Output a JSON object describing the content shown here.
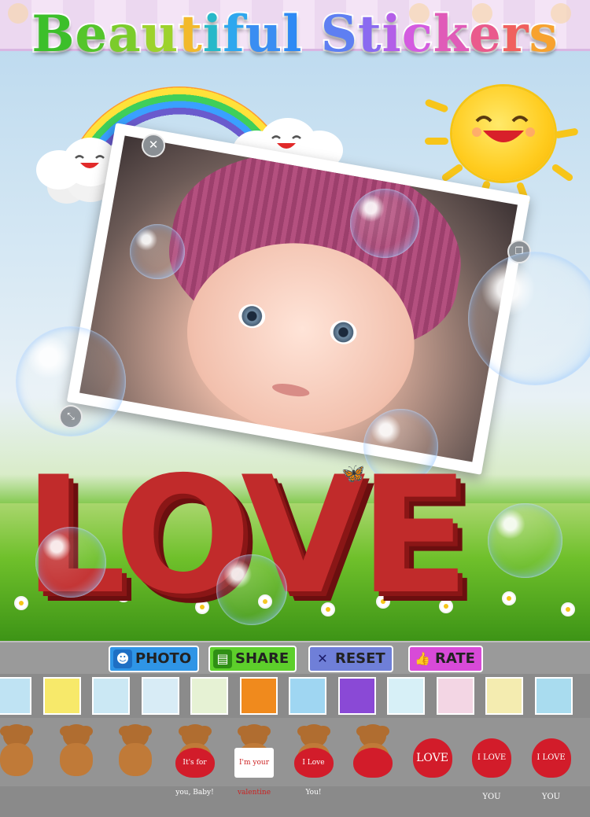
{
  "app": {
    "title_letters": [
      {
        "ch": "B",
        "color": "#3cbf2a"
      },
      {
        "ch": "e",
        "color": "#55c52b"
      },
      {
        "ch": "a",
        "color": "#7bcc2b"
      },
      {
        "ch": "u",
        "color": "#9dd22c"
      },
      {
        "ch": "t",
        "color": "#f2b92b"
      },
      {
        "ch": "i",
        "color": "#27b8c9"
      },
      {
        "ch": "f",
        "color": "#2ea7ee"
      },
      {
        "ch": "u",
        "color": "#3a8ef2"
      },
      {
        "ch": "l",
        "color": "#2e8af4"
      },
      {
        "ch": " ",
        "color": "#000000"
      },
      {
        "ch": "S",
        "color": "#5e7ff2"
      },
      {
        "ch": "t",
        "color": "#8a6af0"
      },
      {
        "ch": "i",
        "color": "#b35ee8"
      },
      {
        "ch": "c",
        "color": "#d45be0"
      },
      {
        "ch": "k",
        "color": "#e05bb8"
      },
      {
        "ch": "e",
        "color": "#ea5a8c"
      },
      {
        "ch": "r",
        "color": "#f0605e"
      },
      {
        "ch": "s",
        "color": "#f7a22f"
      }
    ]
  },
  "canvas": {
    "love_text": "LOVE"
  },
  "toolbar": {
    "buttons": [
      {
        "name": "photo-button",
        "label": "PHOTO",
        "icon": "person-icon",
        "color": "#2f95e6"
      },
      {
        "name": "share-button",
        "label": "SHARE",
        "icon": "save-icon",
        "color": "#5dcf2b"
      },
      {
        "name": "reset-button",
        "label": "RESET",
        "icon": "x-icon",
        "color": "#6f7fd8"
      },
      {
        "name": "rate-button",
        "label": "RATE",
        "icon": "thumbs-up-icon",
        "color": "#d84ad8"
      }
    ]
  },
  "backgrounds": {
    "thumbnails": [
      {
        "color": "#bfe3f3"
      },
      {
        "color": "#f7e96a"
      },
      {
        "color": "#cbe8f4"
      },
      {
        "color": "#d8ecf6"
      },
      {
        "color": "#e6f2d4"
      },
      {
        "color": "#f08a1d"
      },
      {
        "color": "#9fd6f2"
      },
      {
        "color": "#8a49d6"
      },
      {
        "color": "#d7f0f7"
      },
      {
        "color": "#f3d6e4"
      },
      {
        "color": "#f4ecb0"
      },
      {
        "color": "#a9dcef"
      }
    ]
  },
  "stickers": {
    "items": [
      {
        "kind": "bear",
        "caption": ""
      },
      {
        "kind": "bear",
        "caption": ""
      },
      {
        "kind": "bear",
        "caption": ""
      },
      {
        "kind": "bear-heart",
        "caption": "It's for you, Baby!"
      },
      {
        "kind": "bear-card",
        "caption": "I'm your valentine"
      },
      {
        "kind": "bear-heart",
        "caption": "I Love You!"
      },
      {
        "kind": "bear-heart",
        "caption": ""
      },
      {
        "kind": "heart-plain",
        "caption": "LOVE"
      },
      {
        "kind": "heart-plain",
        "caption": "I LOVE YOU"
      },
      {
        "kind": "heart-plain",
        "caption": "I LOVE YOU"
      }
    ]
  }
}
